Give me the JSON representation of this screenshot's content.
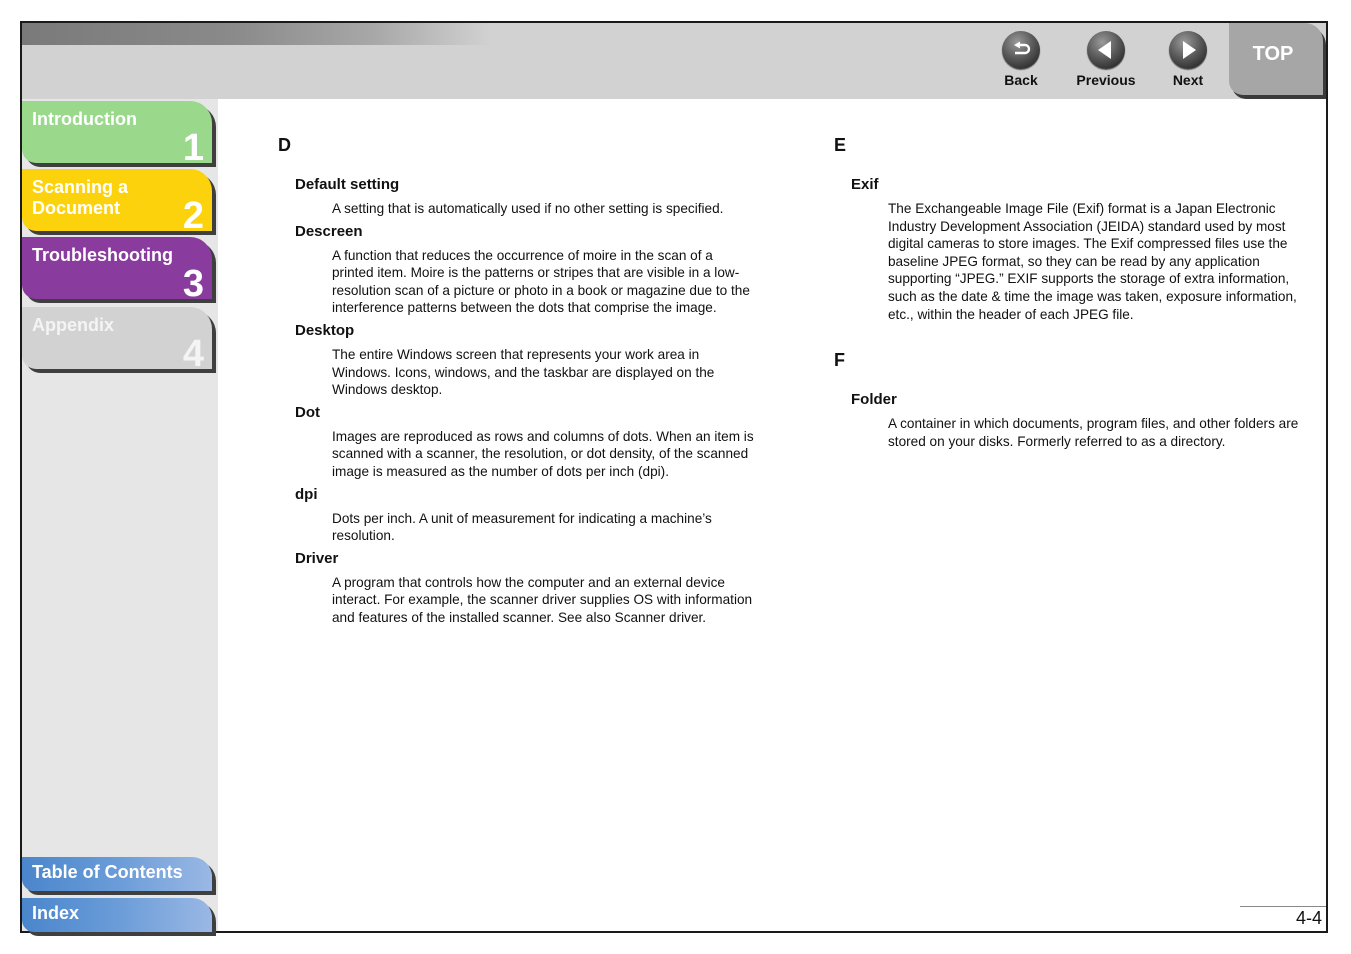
{
  "toolbar": {
    "back_label": "Back",
    "previous_label": "Previous",
    "next_label": "Next",
    "top_label": "TOP"
  },
  "sidebar": {
    "chapters": [
      {
        "title": "Introduction",
        "number": "1",
        "color": "#9ad88c"
      },
      {
        "title": "Scanning a Document",
        "number": "2",
        "color": "#fcd20c"
      },
      {
        "title": "Troubleshooting",
        "number": "3",
        "color": "#8a3c9e"
      },
      {
        "title": "Appendix",
        "number": "4",
        "color": "#d2d2d2"
      }
    ],
    "toc_label": "Table of Contents",
    "index_label": "Index"
  },
  "glossary": {
    "left": {
      "letter": "D",
      "entries": [
        {
          "term": "Default setting",
          "definition": "A setting that is automatically used if no other setting is specified."
        },
        {
          "term": "Descreen",
          "definition": "A function that reduces the occurrence of moire in the scan of a printed item. Moire is the patterns or stripes that are visible in a low-resolution scan of a picture or photo in a book or magazine due to the interference patterns between the dots that comprise the image."
        },
        {
          "term": "Desktop",
          "definition": "The entire Windows screen that represents your work area in Windows. Icons, windows, and the taskbar are displayed on the Windows desktop."
        },
        {
          "term": "Dot",
          "definition": "Images are reproduced as rows and columns of dots. When an item is scanned with a scanner, the resolution, or dot density, of the scanned image is measured as the number of dots per inch (dpi)."
        },
        {
          "term": "dpi",
          "definition": "Dots per inch. A unit of measurement for indicating a machine’s resolution."
        },
        {
          "term": "Driver",
          "definition": "A program that controls how the computer and an external device interact. For example, the scanner driver supplies OS with information and features of the installed scanner. See also Scanner driver."
        }
      ]
    },
    "right": [
      {
        "letter": "E",
        "entries": [
          {
            "term": "Exif",
            "definition": "The Exchangeable Image File (Exif) format is a Japan Electronic Industry Development Association (JEIDA) standard used by most digital cameras to store images. The Exif compressed files use the baseline JPEG format, so they can be read by any application supporting “JPEG.” EXIF supports the storage of extra information, such as the date & time the image was taken, exposure information, etc., within the header of each JPEG file."
          }
        ]
      },
      {
        "letter": "F",
        "entries": [
          {
            "term": "Folder",
            "definition": "A container in which documents, program files, and other folders are stored on your disks. Formerly referred to as a directory."
          }
        ]
      }
    ]
  },
  "page_number": "4-4"
}
